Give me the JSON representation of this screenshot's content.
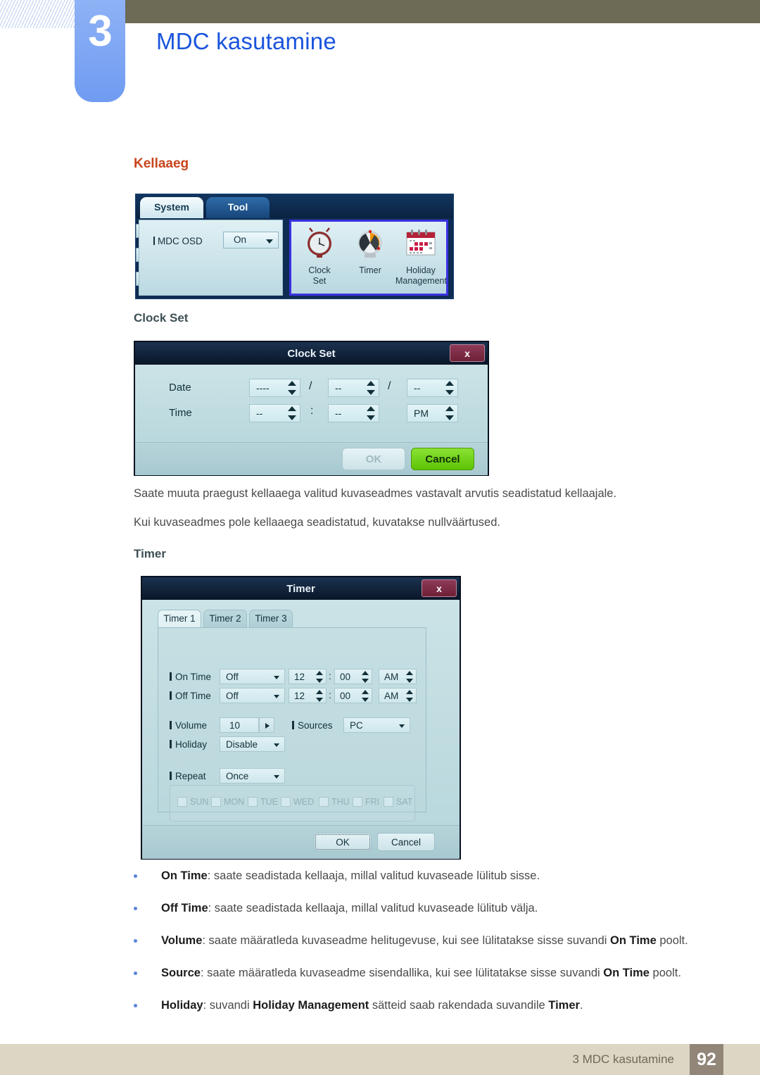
{
  "header": {
    "chapter_number": "3",
    "chapter_title": "MDC kasutamine"
  },
  "section": {
    "heading": "Kellaaeg",
    "sub_clock_set": "Clock Set",
    "sub_timer": "Timer",
    "paragraph_1": "Saate muuta praegust kellaaega valitud kuvaseadmes vastavalt arvutis seadistatud kellaajale.",
    "paragraph_2": "Kui kuvaseadmes pole kellaaega seadistatud, kuvatakse nullväärtused."
  },
  "mdc_strip": {
    "tab_system": "System",
    "tab_tool": "Tool",
    "osd_label": "MDC OSD",
    "osd_value": "On",
    "icons": [
      {
        "caption_line1": "Clock",
        "caption_line2": "Set",
        "icon": "alarm-clock-icon"
      },
      {
        "caption_line1": "Timer",
        "caption_line2": "",
        "icon": "kitchen-timer-icon"
      },
      {
        "caption_line1": "Holiday",
        "caption_line2": "Management",
        "icon": "calendar-icon"
      }
    ]
  },
  "clock_set_dialog": {
    "title": "Clock Set",
    "close_label": "x",
    "date_label": "Date",
    "time_label": "Time",
    "date_year": "----",
    "date_month": "--",
    "date_day": "--",
    "date_sep_1": "/",
    "date_sep_2": "/",
    "time_hour": "--",
    "time_minute": "--",
    "time_meridiem": "PM",
    "time_sep": ":",
    "ok_label": "OK",
    "cancel_label": "Cancel"
  },
  "timer_dialog": {
    "title": "Timer",
    "close_label": "x",
    "tabs": [
      "Timer 1",
      "Timer 2",
      "Timer 3"
    ],
    "rows": {
      "on_time_label": "On Time",
      "on_time_mode": "Off",
      "on_time_hour": "12",
      "on_time_minute": "00",
      "on_time_meridiem": "AM",
      "off_time_label": "Off Time",
      "off_time_mode": "Off",
      "off_time_hour": "12",
      "off_time_minute": "00",
      "off_time_meridiem": "AM",
      "volume_label": "Volume",
      "volume_value": "10",
      "sources_label": "Sources",
      "sources_value": "PC",
      "holiday_label": "Holiday",
      "holiday_value": "Disable",
      "repeat_label": "Repeat",
      "repeat_value": "Once",
      "time_sep": ":"
    },
    "days": [
      "SUN",
      "MON",
      "TUE",
      "WED",
      "THU",
      "FRI",
      "SAT"
    ],
    "ok_label": "OK",
    "cancel_label": "Cancel"
  },
  "bullets": [
    {
      "term": "On Time",
      "rest": ": saate seadistada kellaaja, millal valitud kuvaseade lülitub sisse."
    },
    {
      "term": "Off Time",
      "rest": ": saate seadistada kellaaja, millal valitud kuvaseade lülitub välja."
    },
    {
      "term": "Volume",
      "rest": ": saate määratleda kuvaseadme helitugevuse, kui see lülitatakse sisse suvandi ",
      "term2": "On Time",
      "rest2": " poolt."
    },
    {
      "term": "Source",
      "rest": ": saate määratleda kuvaseadme sisendallika, kui see lülitatakse sisse suvandi ",
      "term2": "On Time",
      "rest2": " poolt."
    },
    {
      "term": "Holiday",
      "rest": ": suvandi ",
      "term2": "Holiday Management",
      "rest2": " sätteid saab rakendada suvandile ",
      "term3": "Timer",
      "rest3": "."
    }
  ],
  "footer": {
    "text": "3 MDC kasutamine",
    "page": "92"
  },
  "colors": {
    "accent_orange": "#c8441b",
    "chapter_blue": "#1a54dd",
    "olive": "#6d6a55",
    "footer_band": "#ddd6c4",
    "page_chip": "#918678",
    "dialog_navy": "#0c1c33",
    "dialog_body": "#c2dde2",
    "cancel_green": "#6ecd10",
    "icon_border_blue": "#3b33e0"
  }
}
